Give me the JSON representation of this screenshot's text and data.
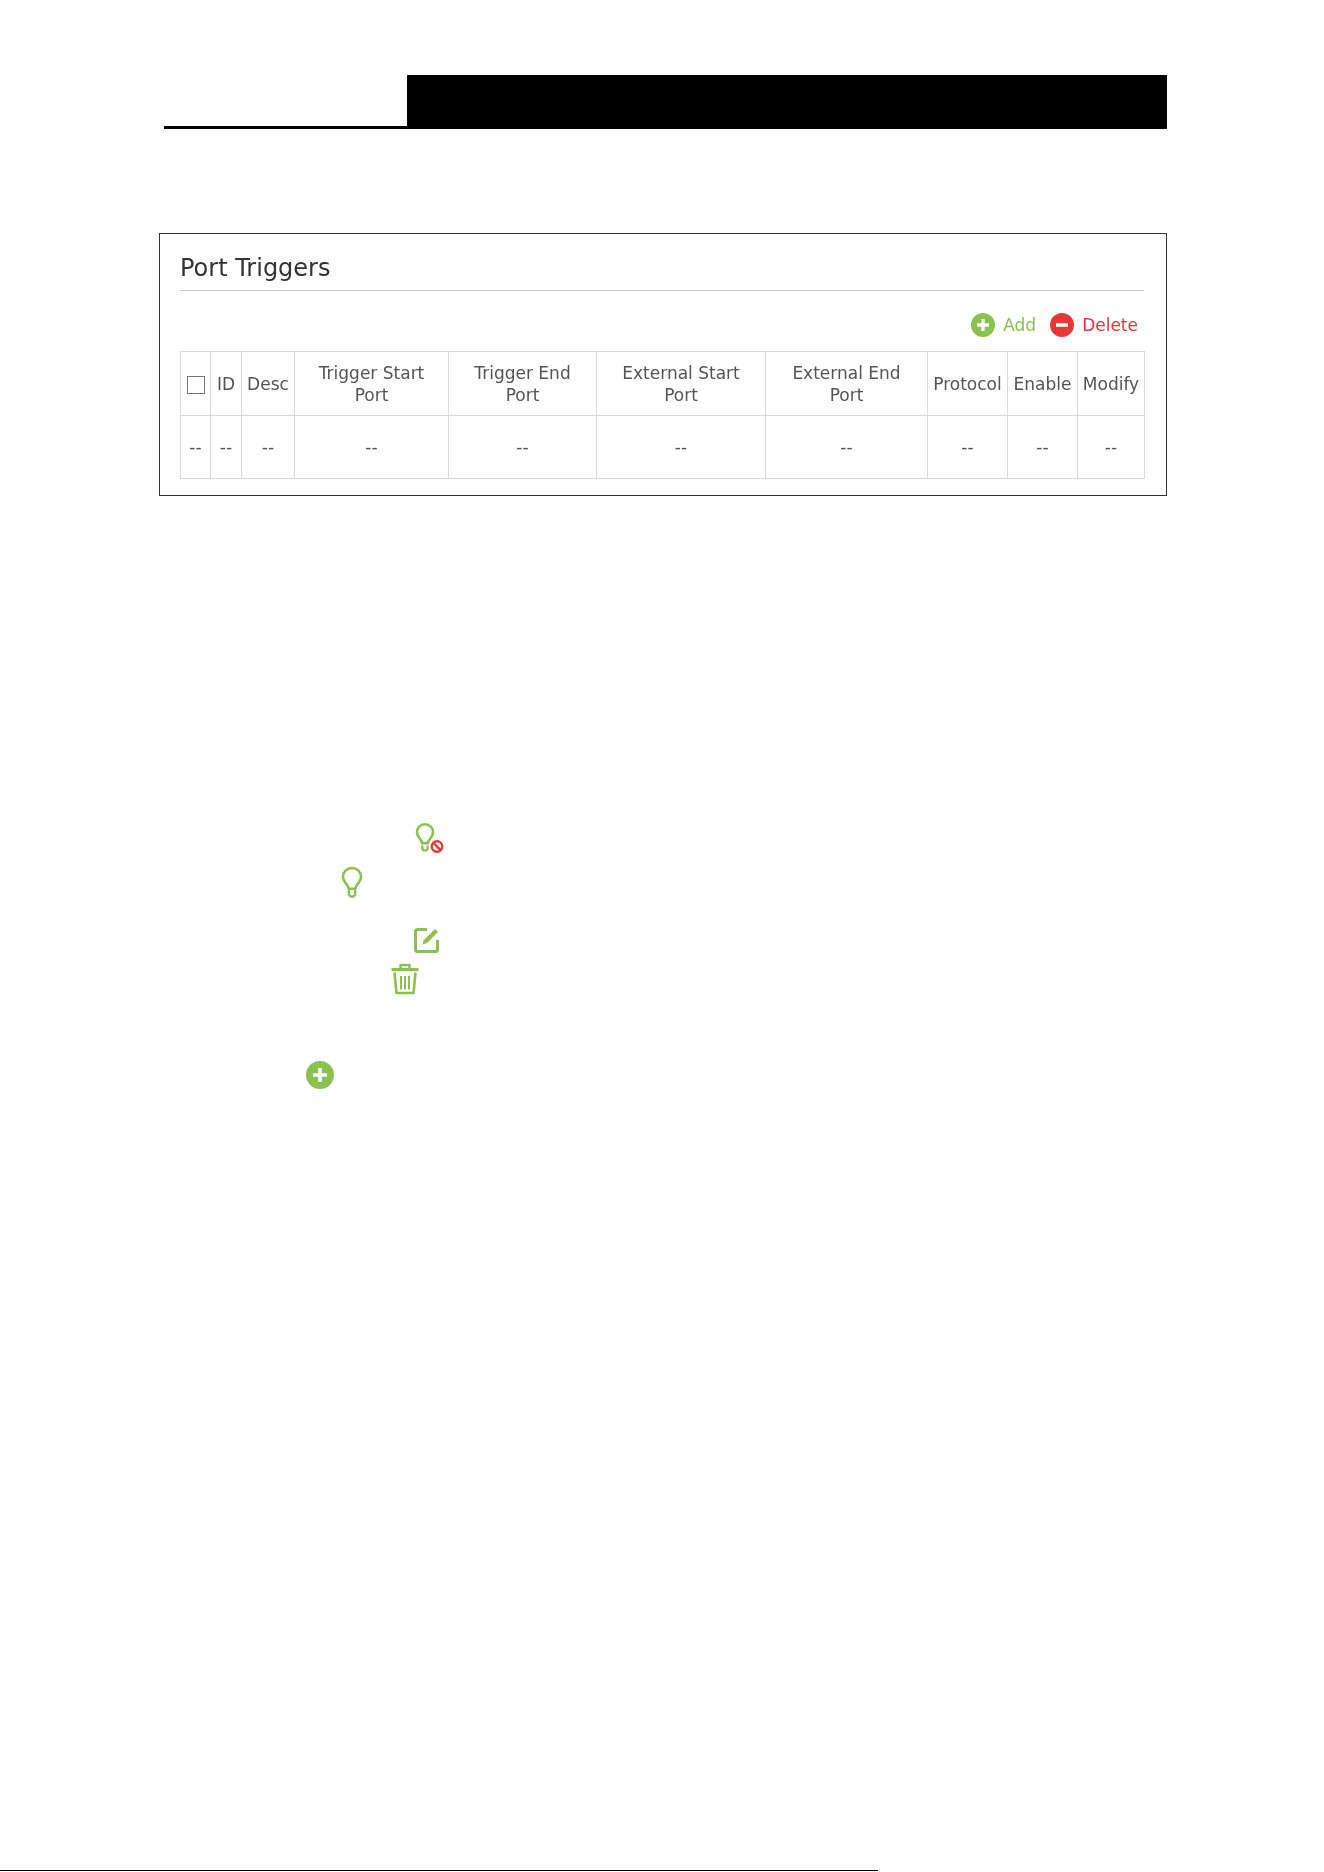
{
  "panel": {
    "title": "Port Triggers",
    "actions": [
      {
        "kind": "add",
        "label": "Add"
      },
      {
        "kind": "delete",
        "label": "Delete"
      }
    ]
  },
  "table": {
    "columns": [
      {
        "kind": "checkbox",
        "checked": false
      },
      {
        "kind": "text",
        "label": "ID"
      },
      {
        "kind": "text",
        "label": "Desc"
      },
      {
        "kind": "text",
        "label": "Trigger Start Port"
      },
      {
        "kind": "text",
        "label": "Trigger End Port"
      },
      {
        "kind": "text",
        "label": "External Start Port"
      },
      {
        "kind": "text",
        "label": "External End Port"
      },
      {
        "kind": "text",
        "label": "Protocol"
      },
      {
        "kind": "text",
        "label": "Enable"
      },
      {
        "kind": "text",
        "label": "Modify"
      }
    ],
    "rows": [
      [
        "--",
        "--",
        "--",
        "--",
        "--",
        "--",
        "--",
        "--",
        "--",
        "--"
      ]
    ]
  }
}
